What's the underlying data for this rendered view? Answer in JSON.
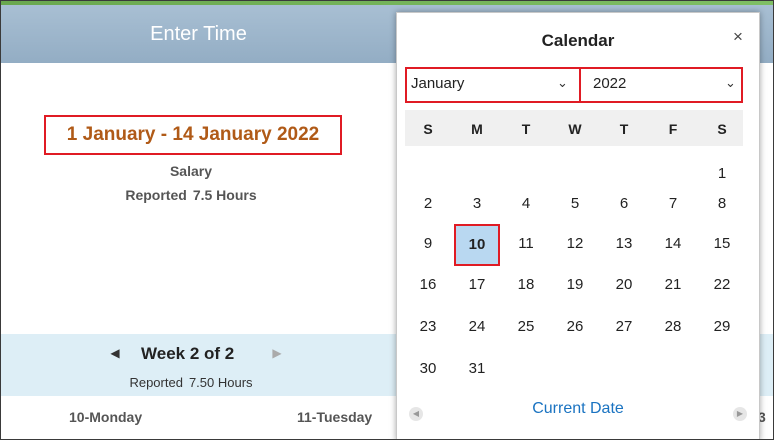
{
  "header": {
    "title": "Enter Time"
  },
  "period": {
    "label": "1 January - 14 January 2022",
    "type": "Salary",
    "reported_label": "Reported",
    "reported_value": "7.5 Hours"
  },
  "week": {
    "label": "Week 2 of 2",
    "reported_label": "Reported",
    "reported_value": "7.50 Hours"
  },
  "days": [
    "10-Monday",
    "11-Tuesday"
  ],
  "edge_digit": "3",
  "calendar": {
    "title": "Calendar",
    "close": "×",
    "month": "January",
    "year": "2022",
    "dow": [
      "S",
      "M",
      "T",
      "W",
      "T",
      "F",
      "S"
    ],
    "dates": [
      "1",
      "2",
      "3",
      "4",
      "5",
      "6",
      "7",
      "8",
      "9",
      "10",
      "11",
      "12",
      "13",
      "14",
      "15",
      "16",
      "17",
      "18",
      "19",
      "20",
      "21",
      "22",
      "23",
      "24",
      "25",
      "26",
      "27",
      "28",
      "29",
      "30",
      "31"
    ],
    "selected": "10",
    "current_date": "Current Date"
  },
  "colors": {
    "period_text": "#b05a17",
    "highlight_border": "#e01b24",
    "selected_fill": "#b9d8f1",
    "link": "#1a73c1"
  }
}
